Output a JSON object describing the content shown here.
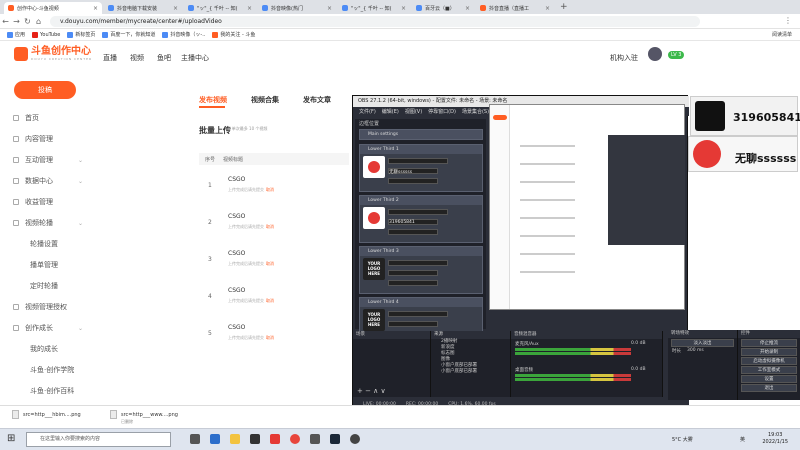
{
  "browser": {
    "tabs": [
      {
        "title": "创作中心-斗鱼视频",
        "active": true,
        "color": "#ff5d23"
      },
      {
        "title": "抖音电脑下载安装",
        "active": false,
        "color": "#4c8bf5"
      },
      {
        "title": "\"ッ\"_{ 千叶 -- 知(",
        "active": false,
        "color": "#4c8bf5"
      },
      {
        "title": "抖音映像(热门",
        "active": false,
        "color": "#4c8bf5"
      },
      {
        "title": "\"ッ\"_{ 千叶 -- 知(",
        "active": false,
        "color": "#4c8bf5"
      },
      {
        "title": "百牙云（■）",
        "active": false,
        "color": "#4c8bf5"
      },
      {
        "title": "抖音直播（直播工",
        "active": false,
        "color": "#ff5d23"
      }
    ],
    "url": "v.douyu.com/member/mycreate/center#/uploadVideo",
    "bookmarks": [
      "应用",
      "YouTube",
      "新标签页",
      "百度一下，你就知道",
      "抖音映像（ッ-..",
      "我的关注 - 斗鱼"
    ],
    "bookmarks_right": "阅读清单"
  },
  "site": {
    "logo_text": "斗鱼创作中心",
    "logo_sub": "DOUYU CREATION CENTER",
    "nav": [
      "直播",
      "视频",
      "鱼吧",
      "主播中心"
    ],
    "user_label": "机构入驻",
    "level_badge": "LV 3"
  },
  "sidebar": {
    "upload_button": "投稿",
    "items": [
      {
        "label": "首页",
        "chevron": false
      },
      {
        "label": "内容管理",
        "chevron": false
      },
      {
        "label": "互动管理",
        "chevron": true
      },
      {
        "label": "数据中心",
        "chevron": true
      },
      {
        "label": "收益管理",
        "chevron": false
      },
      {
        "label": "视频轮播",
        "chevron": true
      }
    ],
    "sub_items_a": [
      "轮播设置",
      "播单管理",
      "定时轮播"
    ],
    "items_b": [
      {
        "label": "视频管理授权",
        "chevron": false
      },
      {
        "label": "创作成长",
        "chevron": true
      }
    ],
    "sub_items_b": [
      "我的成长",
      "斗鱼·创作学院",
      "斗鱼·创作百科"
    ]
  },
  "main": {
    "tabs": [
      "发布视频",
      "视频合集",
      "发布文章"
    ],
    "section_title": "批量上传",
    "section_hint": "● 单次最多 10 个视频",
    "columns": [
      "序号",
      "视频标题"
    ],
    "rows": [
      {
        "no": "1",
        "title": "CSGO",
        "desc": "上传完成后请先提交",
        "action": "取消"
      },
      {
        "no": "2",
        "title": "CSGO",
        "desc": "上传完成后请先提交",
        "action": "取消"
      },
      {
        "no": "3",
        "title": "CSGO",
        "desc": "上传完成后请先提交",
        "action": "取消"
      },
      {
        "no": "4",
        "title": "CSGO",
        "desc": "上传完成后请先提交",
        "action": "取消"
      },
      {
        "no": "5",
        "title": "CSGO",
        "desc": "上传完成后请先提交",
        "action": "取消"
      }
    ]
  },
  "obs": {
    "title": "OBS 27.1.2 (64-bit, windows) - 配置文件: 未命名 - 场景: 未命名",
    "menu": [
      "文件(F)",
      "编辑(E)",
      "视图(V)",
      "停靠窗口(D)",
      "场景集合(S)",
      "配置文件(P)",
      "工具(T)",
      "帮助(H)"
    ],
    "panel_title": "边框位置",
    "main_settings": "Main settings",
    "lower_thirds": [
      {
        "title": "Lower Third 1",
        "logo": "douyu",
        "text": "无聊ssssss"
      },
      {
        "title": "Lower Third 2",
        "logo": "douyu",
        "text": "319605841"
      },
      {
        "title": "Lower Third 3",
        "logo": "yourlogo",
        "text": ""
      },
      {
        "title": "Lower Third 4",
        "logo": "yourlogo",
        "text": ""
      }
    ],
    "your_logo": "YOUR LOGO HERE",
    "scenes_header": "场景",
    "sources_header": "来源",
    "sources": [
      "2播映射",
      "新浪度",
      "标志图",
      "图像",
      "小窗户底部已部署",
      "小窗户底部已部署"
    ],
    "mixer_header": "音频混音器",
    "mixer_tracks": [
      {
        "name": "麦克风/Aux",
        "level": "0.0 dB"
      },
      {
        "name": "桌面音频",
        "level": "0.0 dB"
      }
    ],
    "transition_header": "转场特效",
    "transition_value": "淡入淡出",
    "duration_label": "时长",
    "duration_value": "300 ms",
    "controls_header": "控件",
    "controls": [
      "停止推流",
      "开始录制",
      "启动虚拟摄像机",
      "工作室模式",
      "设置",
      "退出"
    ],
    "status": {
      "dropped": "丢帧",
      "live": "LIVE: 00:00:00",
      "rec": "REC: 00:00:00",
      "cpu": "CPU: 1.6%, 60.00 fps"
    },
    "tabs_bottom": [
      "属性",
      "滤镜"
    ],
    "no_source": "未选择源"
  },
  "overlay": {
    "chat1_number": "319605841",
    "chat2_text": "无聊ssssss"
  },
  "downloads": [
    {
      "name": "src=http___hbim....png",
      "sub": ""
    },
    {
      "name": "src=http___www....png",
      "sub": "已删除"
    }
  ],
  "taskbar": {
    "search_placeholder": "在这里输入你要搜索的内容",
    "weather": "5°C 大雾",
    "lang": "英",
    "time": "19:03",
    "date": "2022/1/15"
  }
}
